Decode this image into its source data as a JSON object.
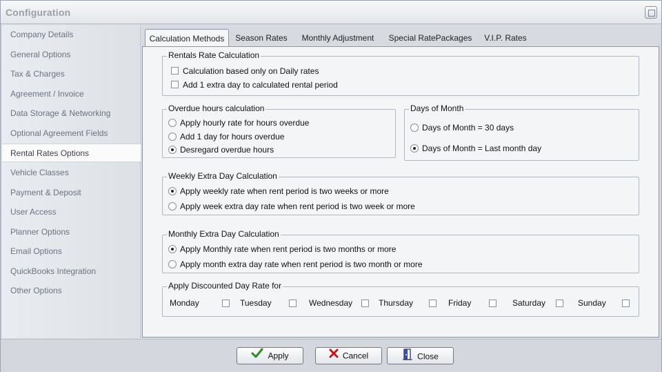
{
  "window": {
    "title": "Configuration"
  },
  "sidebar": {
    "items": [
      {
        "label": "Company Details"
      },
      {
        "label": "General Options"
      },
      {
        "label": "Tax & Charges"
      },
      {
        "label": "Agreement / Invoice"
      },
      {
        "label": "Data Storage & Networking"
      },
      {
        "label": "Optional Agreement Fields"
      },
      {
        "label": "Rental Rates Options",
        "active": true
      },
      {
        "label": "Vehicle Classes"
      },
      {
        "label": "Payment & Deposit"
      },
      {
        "label": "User Access"
      },
      {
        "label": "Planner Options"
      },
      {
        "label": "Email Options"
      },
      {
        "label": "QuickBooks Integration"
      },
      {
        "label": "Other Options"
      }
    ]
  },
  "tabs": [
    {
      "label": "Calculation Methods",
      "active": true
    },
    {
      "label": "Season Rates"
    },
    {
      "label": "Monthly Adjustment"
    },
    {
      "label": "Special RatePackages"
    },
    {
      "label": "V.I.P. Rates"
    }
  ],
  "rentals_group": {
    "title": "Rentals Rate Calculation",
    "options": [
      {
        "label": "Calculation based only on Daily rates",
        "checked": false
      },
      {
        "label": "Add 1 extra day to calculated rental period",
        "checked": false
      }
    ]
  },
  "overdue_group": {
    "title": "Overdue hours calculation",
    "options": [
      {
        "label": "Apply hourly rate for hours overdue",
        "selected": false
      },
      {
        "label": "Add 1 day for hours overdue",
        "selected": false
      },
      {
        "label": "Desregard overdue hours",
        "selected": true
      }
    ]
  },
  "days_group": {
    "title": "Days of Month",
    "options": [
      {
        "label": "Days of Month = 30 days",
        "selected": false
      },
      {
        "label": "Days of Month = Last month day",
        "selected": true
      }
    ]
  },
  "weekly_group": {
    "title": "Weekly Extra Day Calculation",
    "options": [
      {
        "label": "Apply weekly rate when rent period is two weeks or more",
        "selected": true
      },
      {
        "label": "Apply week extra day rate when rent period is two week or more",
        "selected": false
      }
    ]
  },
  "monthly_group": {
    "title": "Monthly Extra Day Calculation",
    "options": [
      {
        "label": "Apply Monthly rate when rent period is two months or more",
        "selected": true
      },
      {
        "label": "Apply month extra day rate when rent period is two month or more",
        "selected": false
      }
    ]
  },
  "discount_group": {
    "title": "Apply Discounted Day Rate for",
    "days": [
      {
        "label": "Monday",
        "checked": false
      },
      {
        "label": "Tuesday",
        "checked": false
      },
      {
        "label": "Wednesday",
        "checked": false
      },
      {
        "label": "Thursday",
        "checked": false
      },
      {
        "label": "Friday",
        "checked": false
      },
      {
        "label": "Saturday",
        "checked": false
      },
      {
        "label": "Sunday",
        "checked": false
      }
    ]
  },
  "buttons": {
    "apply": "Apply",
    "cancel": "Cancel",
    "close": "Close"
  },
  "colors": {
    "apply_icon": "#2e8b22",
    "cancel_icon": "#c4161c",
    "close_icon": "#3b4aa0"
  },
  "icons": {
    "apply": "check-icon",
    "cancel": "x-icon",
    "close": "door-exit-icon",
    "window": "restore-icon"
  }
}
